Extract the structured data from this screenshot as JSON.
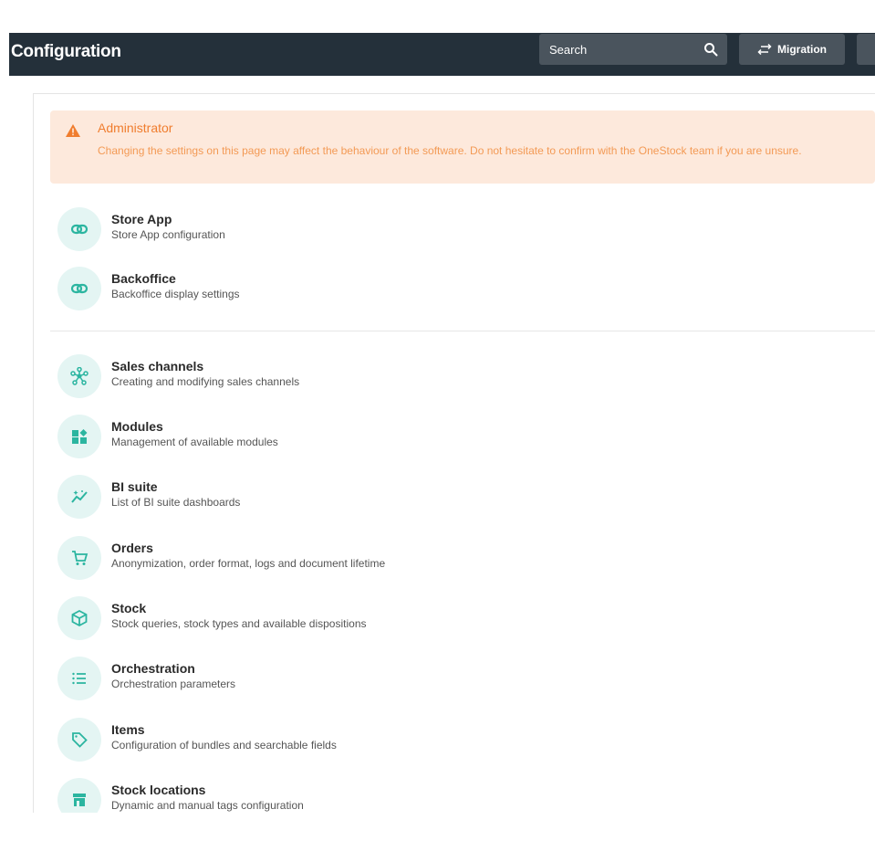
{
  "header": {
    "title": "Configuration",
    "search_label": "Search",
    "migration_label": "Migration",
    "bg_color": "#24303a"
  },
  "alert": {
    "title": "Administrator",
    "text": "Changing the settings on this page may affect the behaviour of the software. Do not hesitate to confirm with the OneStock team if you are unsure.",
    "color": "#f07d2e"
  },
  "items": [
    {
      "name": "Store App",
      "desc": "Store App configuration",
      "icon": "link-icon"
    },
    {
      "name": "Backoffice",
      "desc": "Backoffice display settings",
      "icon": "link-icon"
    },
    {
      "name": "Sales channels",
      "desc": "Creating and modifying sales channels",
      "icon": "network-icon"
    },
    {
      "name": "Modules",
      "desc": "Management of available modules",
      "icon": "widgets-icon"
    },
    {
      "name": "BI suite",
      "desc": "List of BI suite dashboards",
      "icon": "analytics-icon"
    },
    {
      "name": "Orders",
      "desc": "Anonymization, order format, logs and document lifetime",
      "icon": "cart-icon"
    },
    {
      "name": "Stock",
      "desc": "Stock queries, stock types and available dispositions",
      "icon": "box-icon"
    },
    {
      "name": "Orchestration",
      "desc": "Orchestration parameters",
      "icon": "list-icon"
    },
    {
      "name": "Items",
      "desc": "Configuration of bundles and searchable fields",
      "icon": "tag-icon"
    },
    {
      "name": "Stock locations",
      "desc": "Dynamic and manual tags configuration",
      "icon": "store-icon"
    }
  ],
  "accent_color": "#2bb5a0"
}
